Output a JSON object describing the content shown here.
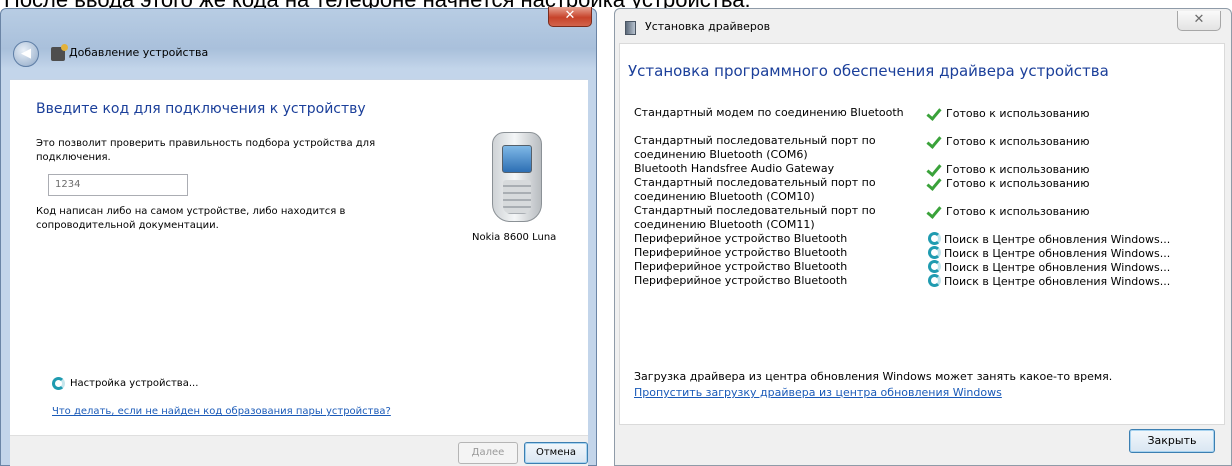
{
  "caption": "После ввода этого же кода на телефоне начнется настройка устройства:",
  "pairing_window": {
    "close_glyph": "✕",
    "back_glyph": "◀",
    "title": "Добавление устройства",
    "heading": "Введите код для подключения к устройству",
    "description": "Это позволит проверить правильность подбора устройства для подключения.",
    "code_value": "1234",
    "hint": "Код написан либо на самом устройстве, либо находится в сопроводительной документации.",
    "device_name": "Nokia 8600 Luna",
    "status_text": "Настройка устройства...",
    "help_link": "Что делать, если не найден код образования пары устройства?",
    "next_button": "Далее",
    "cancel_button": "Отмена",
    "accent_color": "#1b3f9a"
  },
  "driver_window": {
    "title": "Установка драйверов",
    "close_glyph": "✕",
    "heading": "Установка программного обеспечения драйвера устройства",
    "drivers": [
      {
        "name": "Стандартный модем по соединению Bluetooth",
        "status": "Готово к использованию",
        "icon": "check-icon"
      },
      {
        "name": "Стандартный последовательный порт по соединению Bluetooth (COM6)",
        "status": "Готово к использованию",
        "icon": "check-icon"
      },
      {
        "name": "Bluetooth Handsfree Audio Gateway",
        "status": "Готово к использованию",
        "icon": "check-icon"
      },
      {
        "name": "Стандартный последовательный порт по соединению Bluetooth (COM10)",
        "status": "Готово к использованию",
        "icon": "check-icon"
      },
      {
        "name": "Стандартный последовательный порт по соединению Bluetooth (COM11)",
        "status": "Готово к использованию",
        "icon": "check-icon"
      },
      {
        "name": "Периферийное устройство Bluetooth",
        "status": "Поиск в Центре обновления Windows...",
        "icon": "searching-icon"
      },
      {
        "name": "Периферийное устройство Bluetooth",
        "status": "Поиск в Центре обновления Windows...",
        "icon": "searching-icon"
      },
      {
        "name": "Периферийное устройство Bluetooth",
        "status": "Поиск в Центре обновления Windows...",
        "icon": "searching-icon"
      },
      {
        "name": "Периферийное устройство Bluetooth",
        "status": "Поиск в Центре обновления Windows...",
        "icon": "searching-icon"
      }
    ],
    "note": "Загрузка драйвера из центра обновления Windows может занять какое-то время.",
    "skip_link": "Пропустить загрузку драйвера из центра обновления Windows",
    "close_button": "Закрыть"
  }
}
